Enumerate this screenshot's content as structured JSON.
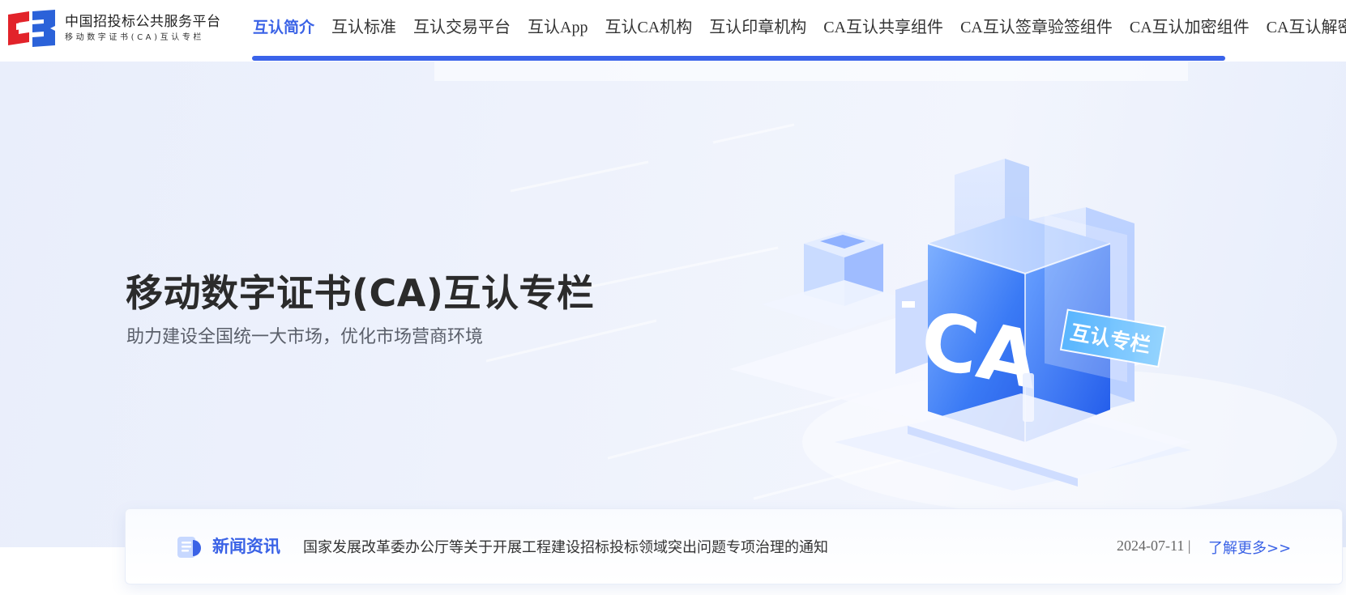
{
  "header": {
    "logo": {
      "title": "中国招投标公共服务平台",
      "subtitle": "移动数字证书(CA)互认专栏",
      "icon": "cb-logo-icon"
    },
    "nav": {
      "items": [
        {
          "label": "互认简介",
          "active": true
        },
        {
          "label": "互认标准",
          "active": false
        },
        {
          "label": "互认交易平台",
          "active": false
        },
        {
          "label": "互认App",
          "active": false
        },
        {
          "label": "互认CA机构",
          "active": false
        },
        {
          "label": "互认印章机构",
          "active": false
        },
        {
          "label": "CA互认共享组件",
          "active": false
        },
        {
          "label": "CA互认签章验签组件",
          "active": false
        },
        {
          "label": "CA互认加密组件",
          "active": false
        },
        {
          "label": "CA互认解密组件",
          "active": false
        }
      ]
    }
  },
  "hero": {
    "title": "移动数字证书(CA)互认专栏",
    "subtitle": "助力建设全国统一大市场，优化市场营商环境",
    "art": {
      "cube_text": "CA",
      "tag_text": "互认专栏"
    }
  },
  "news": {
    "icon": "news-icon",
    "label": "新闻资讯",
    "headline": "国家发展改革委办公厅等关于开展工程建设招标投标领域突出问题专项治理的通知",
    "date": "2024-07-11 |",
    "more_label": "了解更多>>"
  },
  "colors": {
    "accent": "#3a62e6",
    "hero_bg": "#eef2fc",
    "logo_red": "#e2232a",
    "logo_blue": "#2b62d9"
  }
}
